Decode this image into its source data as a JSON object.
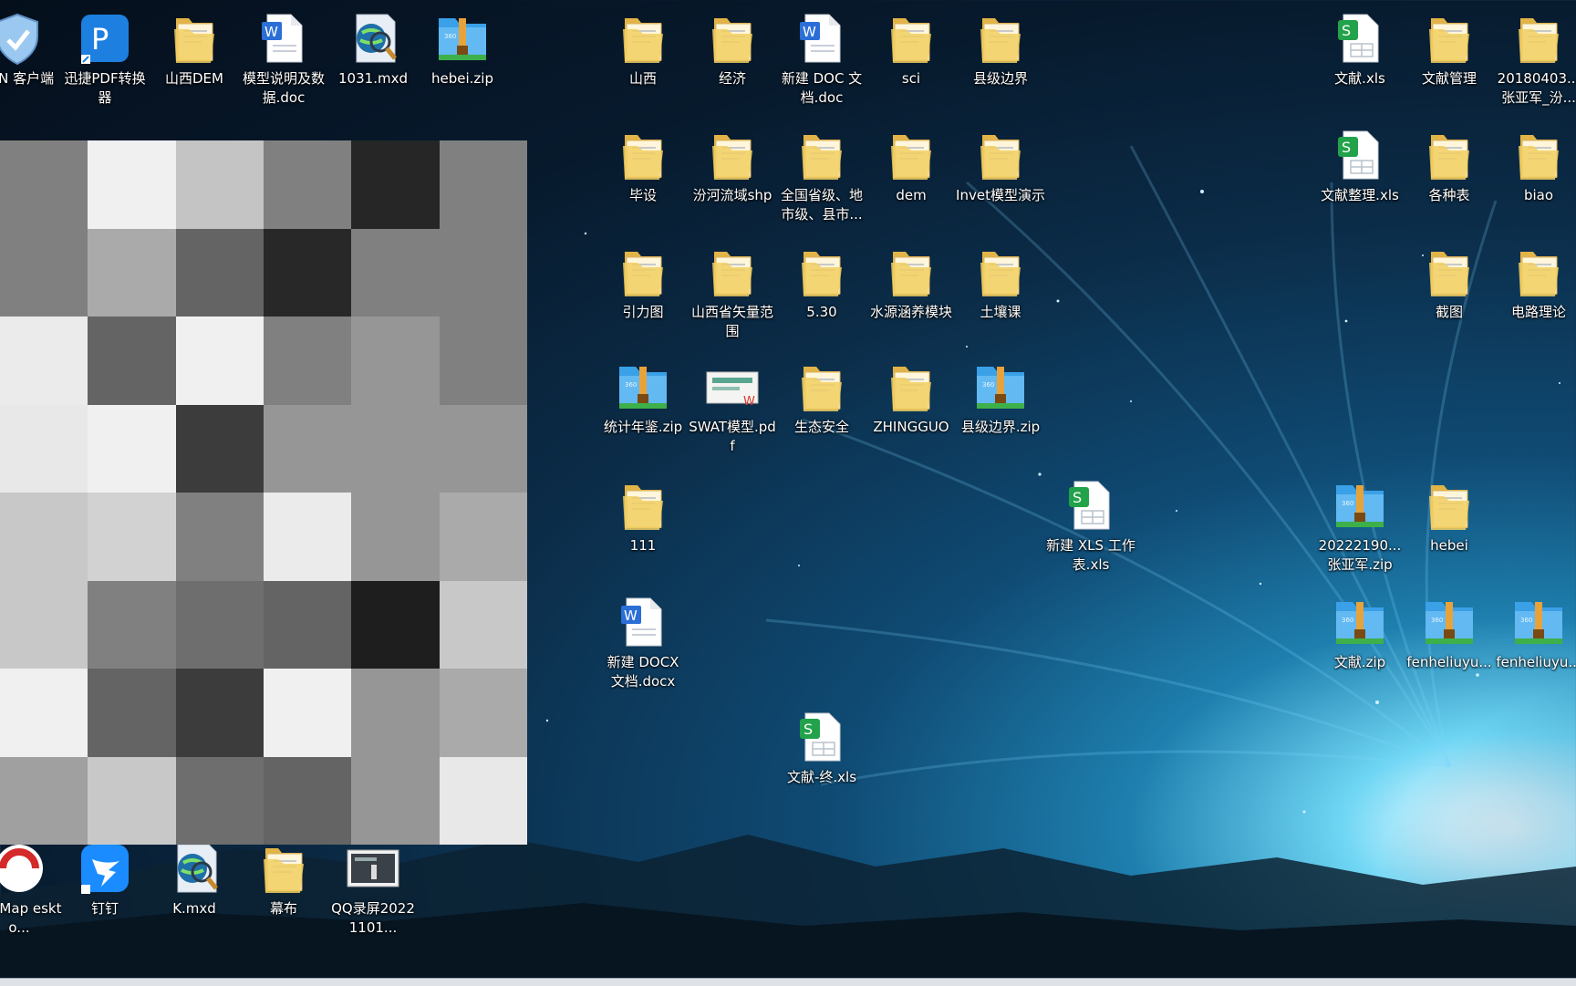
{
  "desktop_icons": [
    {
      "label": "VPN 客户端",
      "type": "shield"
    },
    {
      "label": "迅捷PDF转换器",
      "type": "pdfapp"
    },
    {
      "label": "山西DEM",
      "type": "folder"
    },
    {
      "label": "模型说明及数据.doc",
      "type": "doc"
    },
    {
      "label": "1031.mxd",
      "type": "mxd"
    },
    {
      "label": "hebei.zip",
      "type": "zip"
    },
    {
      "label": "山西",
      "type": "folder"
    },
    {
      "label": "经济",
      "type": "folder"
    },
    {
      "label": "新建 DOC 文档.doc",
      "type": "doc"
    },
    {
      "label": "sci",
      "type": "folder"
    },
    {
      "label": "县级边界",
      "type": "folder"
    },
    {
      "label": "文献.xls",
      "type": "xls"
    },
    {
      "label": "文献管理",
      "type": "folder"
    },
    {
      "label": "20180403...张亚军_汾...",
      "type": "folder"
    },
    {
      "label": "毕设",
      "type": "folder"
    },
    {
      "label": "汾河流域shp",
      "type": "folder"
    },
    {
      "label": "全国省级、地市级、县市...",
      "type": "folder"
    },
    {
      "label": "dem",
      "type": "folder"
    },
    {
      "label": "Invet模型演示",
      "type": "folder"
    },
    {
      "label": "文献整理.xls",
      "type": "xls"
    },
    {
      "label": "各种表",
      "type": "folder"
    },
    {
      "label": "biao",
      "type": "folder"
    },
    {
      "label": "引力图",
      "type": "folder"
    },
    {
      "label": "山西省矢量范围",
      "type": "folder"
    },
    {
      "label": "5.30",
      "type": "folder"
    },
    {
      "label": "水源涵养模块",
      "type": "folder"
    },
    {
      "label": "土壤课",
      "type": "folder"
    },
    {
      "label": "截图",
      "type": "folder"
    },
    {
      "label": "电路理论",
      "type": "folder"
    },
    {
      "label": "统计年鉴.zip",
      "type": "zip"
    },
    {
      "label": "SWAT模型.pdf",
      "type": "pdf"
    },
    {
      "label": "生态安全",
      "type": "folder"
    },
    {
      "label": "ZHINGGUO",
      "type": "folder"
    },
    {
      "label": "县级边界.zip",
      "type": "zip"
    },
    {
      "label": "111",
      "type": "folder"
    },
    {
      "label": "新建 XLS 工作表.xls",
      "type": "xls"
    },
    {
      "label": "20222190...张亚军.zip",
      "type": "zip"
    },
    {
      "label": "hebei",
      "type": "folder"
    },
    {
      "label": "新建 DOCX 文档.docx",
      "type": "doc"
    },
    {
      "label": "文献.zip",
      "type": "zip"
    },
    {
      "label": "fenheliuyu...",
      "type": "zip"
    },
    {
      "label": "fenheliuyu...",
      "type": "zip"
    },
    {
      "label": "文献-终.xls",
      "type": "xls"
    },
    {
      "label": "perMap eskto...",
      "type": "supermap"
    },
    {
      "label": "钉钉",
      "type": "dingtalk"
    },
    {
      "label": "K.mxd",
      "type": "mxd"
    },
    {
      "label": "幕布",
      "type": "folder"
    },
    {
      "label": "QQ录屏20221101...",
      "type": "video"
    }
  ],
  "colors": {
    "folder": "#f2cf62",
    "zip_blue": "#3aa0e8",
    "zip_band": "#e8a23a",
    "doc_blue": "#2b6fd6",
    "xls_green": "#22a24a",
    "pdf_red": "#d9352a"
  },
  "mosaic_gray_levels": [
    [
      128,
      240,
      196,
      128,
      38,
      128
    ],
    [
      128,
      170,
      100,
      40,
      128,
      128
    ],
    [
      235,
      100,
      240,
      128,
      150,
      128
    ],
    [
      232,
      240,
      60,
      150,
      150,
      150
    ],
    [
      200,
      210,
      128,
      235,
      150,
      170
    ],
    [
      200,
      128,
      110,
      100,
      30,
      200
    ],
    [
      240,
      100,
      60,
      240,
      150,
      170
    ],
    [
      160,
      200,
      110,
      100,
      150,
      232
    ]
  ]
}
